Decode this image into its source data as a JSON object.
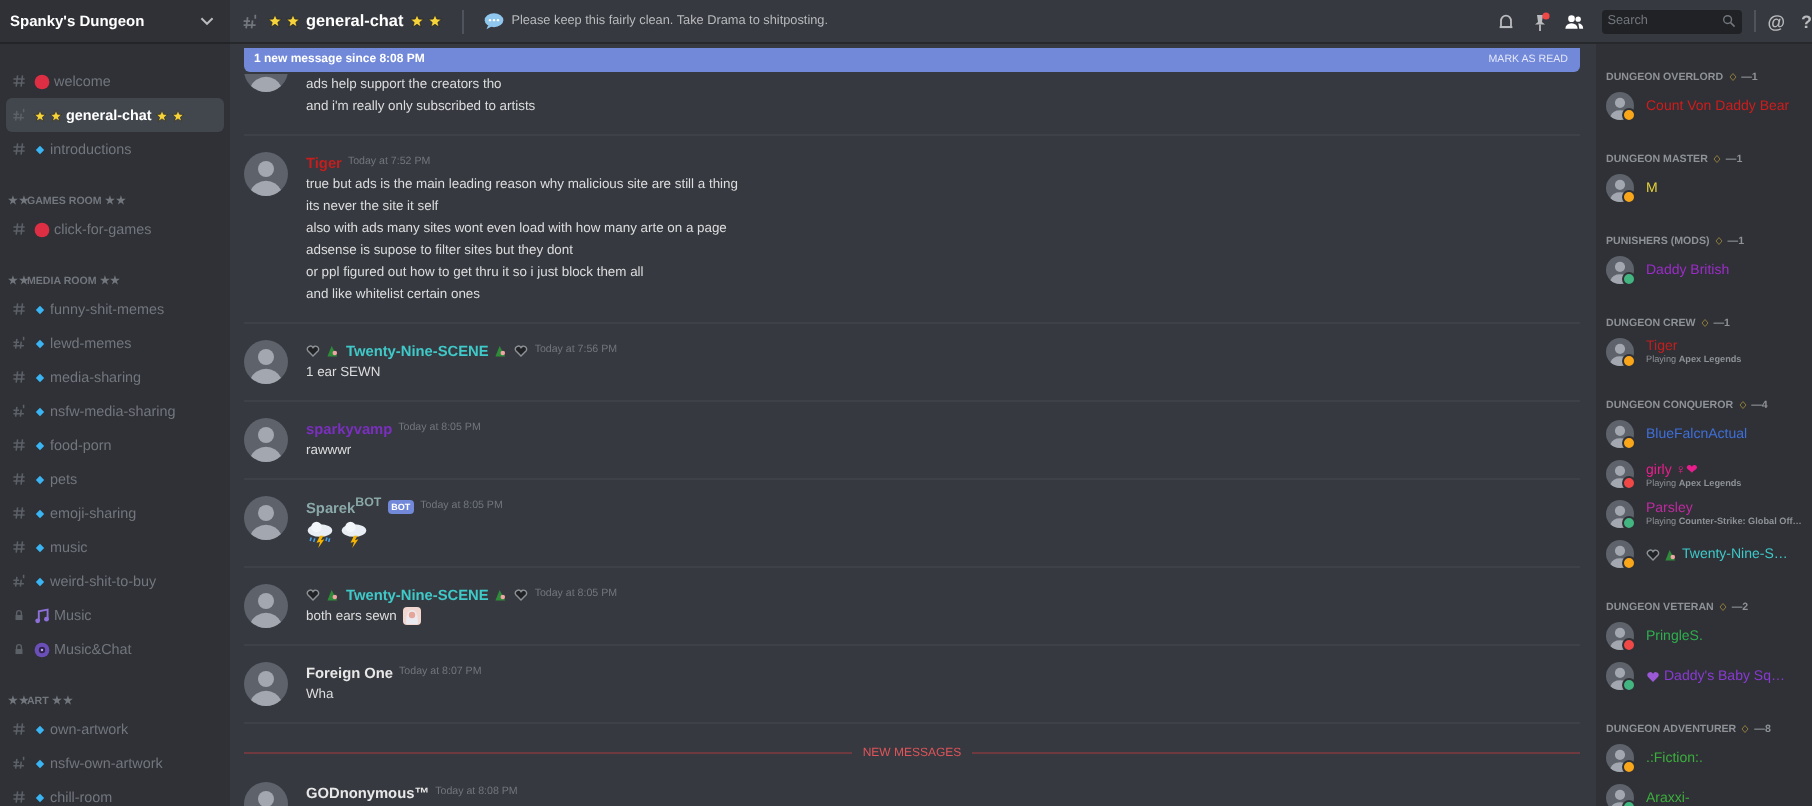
{
  "server": {
    "name": "Spanky's Dungeon"
  },
  "sidebar": {
    "items": [
      {
        "kind": "text-dot",
        "name": "welcome",
        "selected": false
      },
      {
        "kind": "nsfw-stars",
        "name": "general-chat",
        "selected": true
      },
      {
        "kind": "text-diamond",
        "name": "introductions",
        "selected": false
      },
      {
        "kind": "category",
        "label": "★ ★GAMES ROOM ★ ★"
      },
      {
        "kind": "text-dot",
        "name": "click-for-games",
        "selected": false
      },
      {
        "kind": "category",
        "label": "★ ★MEDIA ROOM ★ ★"
      },
      {
        "kind": "text-diamond",
        "name": "funny-shit-memes",
        "selected": false
      },
      {
        "kind": "nsfw-diamond",
        "name": "lewd-memes",
        "selected": false
      },
      {
        "kind": "text-diamond",
        "name": "media-sharing",
        "selected": false
      },
      {
        "kind": "nsfw-diamond",
        "name": "nsfw-media-sharing",
        "selected": false
      },
      {
        "kind": "text-diamond",
        "name": "food-porn",
        "selected": false
      },
      {
        "kind": "text-diamond",
        "name": "pets",
        "selected": false
      },
      {
        "kind": "text-diamond",
        "name": "emoji-sharing",
        "selected": false
      },
      {
        "kind": "text-diamond",
        "name": "music",
        "selected": false
      },
      {
        "kind": "nsfw-diamond",
        "name": "weird-shit-to-buy",
        "selected": false
      },
      {
        "kind": "locked-note",
        "name": "Music",
        "selected": false
      },
      {
        "kind": "locked-speaker",
        "name": "Music&Chat",
        "selected": false
      },
      {
        "kind": "category",
        "label": "★ ★ART ★ ★"
      },
      {
        "kind": "text-diamond",
        "name": "own-artwork",
        "selected": false
      },
      {
        "kind": "nsfw-diamond",
        "name": "nsfw-own-artwork",
        "selected": false
      },
      {
        "kind": "text-diamond",
        "name": "chill-room",
        "selected": false
      }
    ]
  },
  "header": {
    "kind": "nsfw-stars",
    "channel": "general-chat",
    "topic": "Please keep this fairly clean. Take Drama to shitposting.",
    "pins_unread": true,
    "search": {
      "placeholder": "Search"
    },
    "mentions": "@",
    "help": "?"
  },
  "banner": {
    "text": "1 new message since 8:08 PM",
    "action": "MARK AS READ"
  },
  "messages": [
    {
      "kind": "continuation",
      "lines": [
        "ads help support the creators tho",
        "and i'm really only subscribed to artists"
      ]
    },
    {
      "kind": "message",
      "author": "Tiger",
      "color": "#c41e1e",
      "time": "Today at 7:52 PM",
      "lines": [
        "true but ads is the main leading reason why malicious site are still a thing",
        "its never the site it self",
        "also with ads many sites wont even load with how many arte on a page",
        "adsense is supose to filter sites but they dont",
        "or ppl figured out how to get thru it so i just block them all",
        "and like whitelist certain ones"
      ]
    },
    {
      "kind": "message",
      "author": "Twenty-Nine-SCENE",
      "color": "#3fc9c9",
      "decorated": true,
      "time": "Today at 7:56 PM",
      "lines": [
        "1 ear SEWN"
      ]
    },
    {
      "kind": "message",
      "author": "sparkyvamp",
      "color": "#7b2fbf",
      "time": "Today at 8:05 PM",
      "lines": [
        "rawwwr"
      ]
    },
    {
      "kind": "message",
      "author": "Sparek$^{BOT}$",
      "color": "#8aa8a8",
      "badge": "BOT",
      "time": "Today at 8:05 PM",
      "emoji_line": true
    },
    {
      "kind": "message",
      "author": "Twenty-Nine-SCENE",
      "color": "#3fc9c9",
      "decorated": true,
      "time": "Today at 8:05 PM",
      "lines": [
        "both ears sewn"
      ],
      "trailing_emoji": true
    },
    {
      "kind": "message",
      "author": "Foreign One",
      "color": "#e8e8e8",
      "time": "Today at 8:07 PM",
      "lines": [
        "Wha"
      ]
    },
    {
      "kind": "divider",
      "label": "NEW MESSAGES"
    },
    {
      "kind": "message",
      "author": "GODnonymous™",
      "color": "#e8e8e8",
      "time": "Today at 8:08 PM"
    }
  ],
  "members": [
    {
      "title": "DUNGEON OVERLORD",
      "count": "—1",
      "members": [
        {
          "kind": "plain",
          "name": {
            "text": "Count Von Daddy Bear",
            "color": "#d11c1c"
          },
          "status": {
            "color": "#faa61a"
          }
        }
      ]
    },
    {
      "title": "DUNGEON MASTER",
      "count": "—1",
      "members": [
        {
          "kind": "plain",
          "name": {
            "text": "M",
            "color": "#e6d23a"
          },
          "status": {
            "color": "#faa61a"
          }
        }
      ]
    },
    {
      "title": "PUNISHERS (MODS)",
      "count": "—1",
      "members": [
        {
          "kind": "plain",
          "name": {
            "text": "Daddy British",
            "color": "#9b2cc8"
          },
          "status": {
            "color": "#43b581"
          }
        }
      ]
    },
    {
      "title": "DUNGEON CREW",
      "count": "—1",
      "members": [
        {
          "kind": "plain",
          "name": {
            "text": "Tiger",
            "color": "#c41e1e"
          },
          "status": {
            "color": "#faa61a"
          },
          "activity": "Playing **Apex Legends**"
        }
      ]
    },
    {
      "title": "DUNGEON CONQUEROR",
      "count": "—4",
      "members": [
        {
          "kind": "plain",
          "name": {
            "text": "BlueFalcnActual",
            "color": "#3f6fd8"
          },
          "status": {
            "color": "#faa61a"
          }
        },
        {
          "kind": "plain",
          "name": {
            "text": "girly ♀❤",
            "color": "#e91e8c"
          },
          "status": {
            "color": "#f04747"
          },
          "activity": "Playing **Apex Legends**"
        },
        {
          "kind": "plain",
          "name": {
            "text": "Parsley",
            "color": "#c02aa0"
          },
          "status": {
            "color": "#43b581"
          },
          "activity": "Playing **Counter-Strike: Global Off…**"
        },
        {
          "kind": "heart-plant",
          "name": {
            "text": "Twenty-Nine-S…",
            "color": "#3fc9c9"
          },
          "status": {
            "color": "#faa61a"
          }
        }
      ]
    },
    {
      "title": "DUNGEON VETERAN",
      "count": "—2",
      "members": [
        {
          "kind": "plain",
          "name": {
            "text": "PringleS.",
            "color": "#2fae4e"
          },
          "status": {
            "color": "#f04747"
          }
        },
        {
          "kind": "heart",
          "name": {
            "text": "Daddy's Baby Sq…",
            "color": "#8a3ad4"
          },
          "status": {
            "color": "#43b581"
          }
        }
      ]
    },
    {
      "title": "DUNGEON ADVENTURER",
      "count": "—8",
      "members": [
        {
          "kind": "plain",
          "name": {
            "text": ".:Fiction:.",
            "color": "#3cae3c"
          },
          "status": {
            "color": "#faa61a"
          }
        },
        {
          "kind": "plain",
          "name": {
            "text": "Araxxi-",
            "color": "#3cae3c"
          },
          "status": {
            "color": "#43b581"
          }
        }
      ]
    }
  ]
}
